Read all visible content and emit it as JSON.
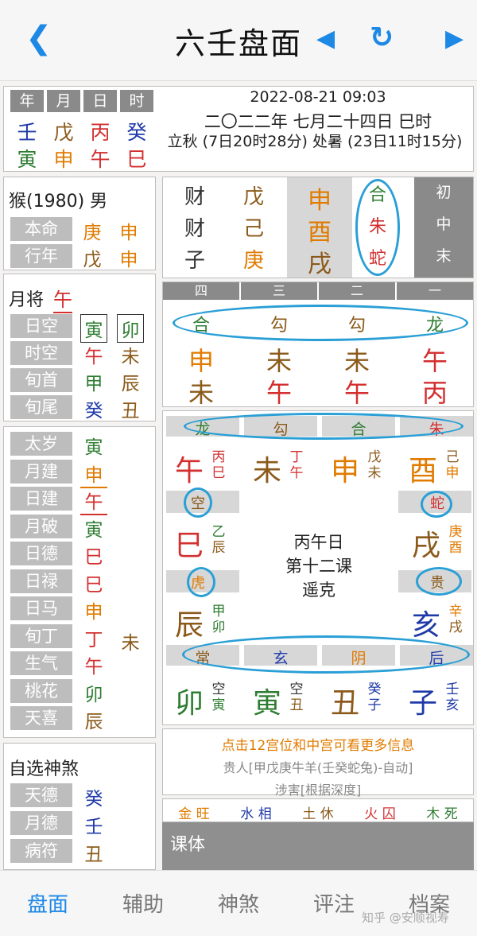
{
  "header": {
    "title": "六壬盘面",
    "back_icon": "chevron-left-icon",
    "prev_icon": "triangle-left-icon",
    "refresh_icon": "refresh-icon",
    "next_icon": "triangle-right-icon"
  },
  "pillars": {
    "headers": [
      "年",
      "月",
      "日",
      "时"
    ],
    "stems": [
      "壬",
      "戊",
      "丙",
      "癸"
    ],
    "branches": [
      "寅",
      "申",
      "午",
      "巳"
    ]
  },
  "datetime": {
    "line1": "2022-08-21 09:03",
    "line2": "二〇二二年 七月二十四日 巳时",
    "line3": "立秋 (7日20时28分) 处暑 (23日11时15分)"
  },
  "person": {
    "title": "猴(1980) 男",
    "rows": [
      {
        "label": "本命",
        "v1": "庚",
        "v2": "申"
      },
      {
        "label": "行年",
        "v1": "戊",
        "v2": "申"
      }
    ]
  },
  "yuejiang": {
    "label": "月将",
    "value": "午"
  },
  "kong": [
    {
      "label": "日空",
      "v1": "寅",
      "v2": "卯"
    },
    {
      "label": "时空",
      "v1": "午",
      "v2": "未"
    },
    {
      "label": "旬首",
      "v1": "甲",
      "v2": "辰"
    },
    {
      "label": "旬尾",
      "v1": "癸",
      "v2": "丑"
    }
  ],
  "shensha": [
    {
      "label": "太岁",
      "v": "寅"
    },
    {
      "label": "月建",
      "v": "申"
    },
    {
      "label": "日建",
      "v": "午"
    },
    {
      "label": "月破",
      "v": "寅"
    },
    {
      "label": "日德",
      "v": "巳"
    },
    {
      "label": "日禄",
      "v": "巳"
    },
    {
      "label": "日马",
      "v": "申"
    },
    {
      "label": "旬丁",
      "v": "丁",
      "v2": "未"
    },
    {
      "label": "生气",
      "v": "午"
    },
    {
      "label": "桃花",
      "v": "卯"
    },
    {
      "label": "天喜",
      "v": "辰"
    }
  ],
  "custom": {
    "title": "自选神煞",
    "rows": [
      {
        "label": "天德",
        "v": "癸"
      },
      {
        "label": "月德",
        "v": "壬"
      },
      {
        "label": "病符",
        "v": "丑"
      }
    ]
  },
  "sanchuan": {
    "rows": [
      {
        "q": "财",
        "g": "戊",
        "z": "申",
        "s": "合",
        "lab": "初"
      },
      {
        "q": "财",
        "g": "己",
        "z": "酉",
        "s": "朱",
        "lab": "中"
      },
      {
        "q": "子",
        "g": "庚",
        "z": "戌",
        "s": "蛇",
        "lab": "末"
      }
    ]
  },
  "sike": {
    "headers": [
      "四",
      "三",
      "二",
      "一"
    ],
    "jiang": [
      "合",
      "勾",
      "勾",
      "龙"
    ],
    "top": [
      "申",
      "未",
      "未",
      "午"
    ],
    "bottom": [
      "未",
      "午",
      "午",
      "丙"
    ]
  },
  "tianpan": {
    "top_jiang": [
      "龙",
      "勾",
      "合",
      "朱"
    ],
    "top": [
      {
        "z": "午",
        "a": "丙",
        "b": "巳"
      },
      {
        "z": "未",
        "a": "丁",
        "b": "午"
      },
      {
        "z": "申",
        "a": "戊",
        "b": "未"
      },
      {
        "z": "酉",
        "a": "己",
        "b": "申"
      }
    ],
    "left": [
      {
        "j": "空",
        "z": "巳",
        "a": "乙",
        "b": "辰"
      },
      {
        "j": "虎",
        "z": "辰",
        "a": "甲",
        "b": "卯"
      }
    ],
    "right": [
      {
        "j": "蛇",
        "z": "戌",
        "a": "庚",
        "b": "酉"
      },
      {
        "j": "贵",
        "z": "亥",
        "a": "辛",
        "b": "戌"
      }
    ],
    "bottom_jiang": [
      "常",
      "玄",
      "阴",
      "后"
    ],
    "bottom": [
      {
        "z": "卯",
        "a": "空",
        "b": "寅"
      },
      {
        "z": "寅",
        "a": "空",
        "b": "丑"
      },
      {
        "z": "丑",
        "a": "癸",
        "b": "子"
      },
      {
        "z": "子",
        "a": "壬",
        "b": "亥"
      }
    ],
    "center": [
      "丙午日",
      "第十二课",
      "遥克"
    ]
  },
  "info": {
    "line1": "点击12宫位和中宫可看更多信息",
    "line2": "贵人[甲戊庚牛羊(壬癸蛇兔)-自动]",
    "line3": "涉害[根据深度]"
  },
  "wangxiang": [
    {
      "e": "金",
      "s": "旺"
    },
    {
      "e": "水",
      "s": "相"
    },
    {
      "e": "土",
      "s": "休"
    },
    {
      "e": "火",
      "s": "囚"
    },
    {
      "e": "木",
      "s": "死"
    }
  ],
  "keti": "课体",
  "tabs": [
    "盘面",
    "辅助",
    "神煞",
    "评注",
    "档案"
  ],
  "watermark": "知乎 @安顺视寿",
  "colors": {
    "accent": "#1e88e5",
    "circle": "#2a9fd6"
  }
}
